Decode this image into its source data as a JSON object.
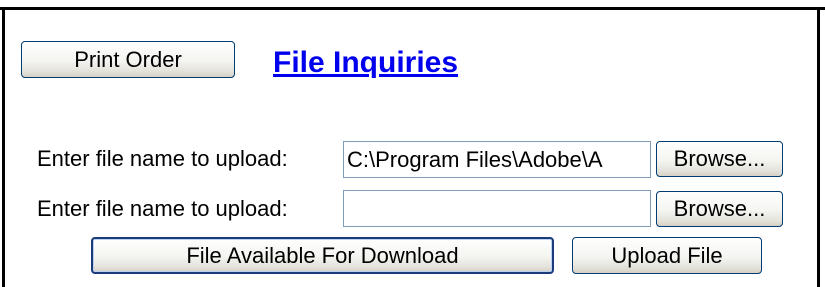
{
  "header": {
    "print_label": "Print Order",
    "title": "File Inquiries"
  },
  "upload": {
    "rows": [
      {
        "label": "Enter file name to upload:",
        "value": "C:\\Program Files\\Adobe\\A",
        "browse_label": "Browse..."
      },
      {
        "label": "Enter file name to upload:",
        "value": "",
        "browse_label": "Browse..."
      }
    ]
  },
  "actions": {
    "download_label": "File Available For Download",
    "upload_label": "Upload File"
  },
  "colors": {
    "link": "#0000ee",
    "button_border": "#003c74",
    "input_border": "#7f9db9"
  }
}
